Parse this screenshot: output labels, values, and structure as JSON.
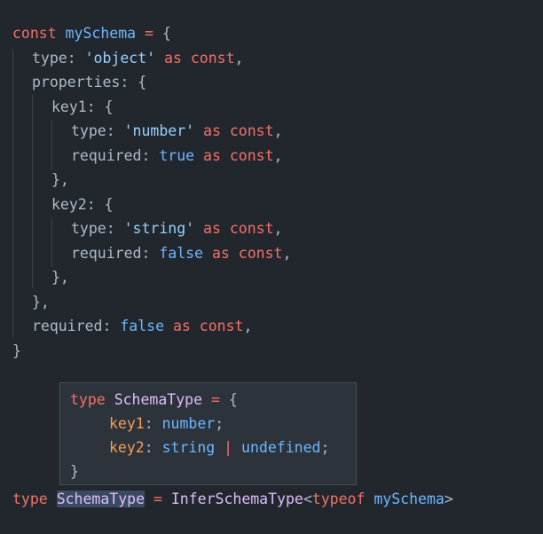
{
  "code": {
    "l1": [
      "const",
      "mySchema",
      "=",
      "{"
    ],
    "l2": [
      "type:",
      "'object'",
      "as",
      "const",
      ","
    ],
    "l3": [
      "properties:",
      "{"
    ],
    "l4": [
      "key1:",
      "{"
    ],
    "l5": [
      "type:",
      "'number'",
      "as",
      "const",
      ","
    ],
    "l6": [
      "required:",
      "true",
      "as",
      "const",
      ","
    ],
    "l7": [
      "},"
    ],
    "l8": [
      "key2:",
      "{"
    ],
    "l9": [
      "type:",
      "'string'",
      "as",
      "const",
      ","
    ],
    "l10": [
      "required:",
      "false",
      "as",
      "const",
      ","
    ],
    "l11": [
      "},"
    ],
    "l12": [
      "},"
    ],
    "l13": [
      "required:",
      "false",
      "as",
      "const",
      ","
    ],
    "l14": [
      "}"
    ],
    "l15": [
      "type",
      "SchemaType",
      "=",
      "InferSchemaType",
      "<",
      "typeof",
      "mySchema",
      ">"
    ]
  },
  "tooltip": {
    "t1": [
      "type",
      "SchemaType",
      "=",
      "{"
    ],
    "t2": [
      "key1",
      ":",
      "number",
      ";"
    ],
    "t3": [
      "key2",
      ":",
      "string",
      "|",
      "undefined",
      ";"
    ],
    "t4": [
      "}"
    ]
  }
}
